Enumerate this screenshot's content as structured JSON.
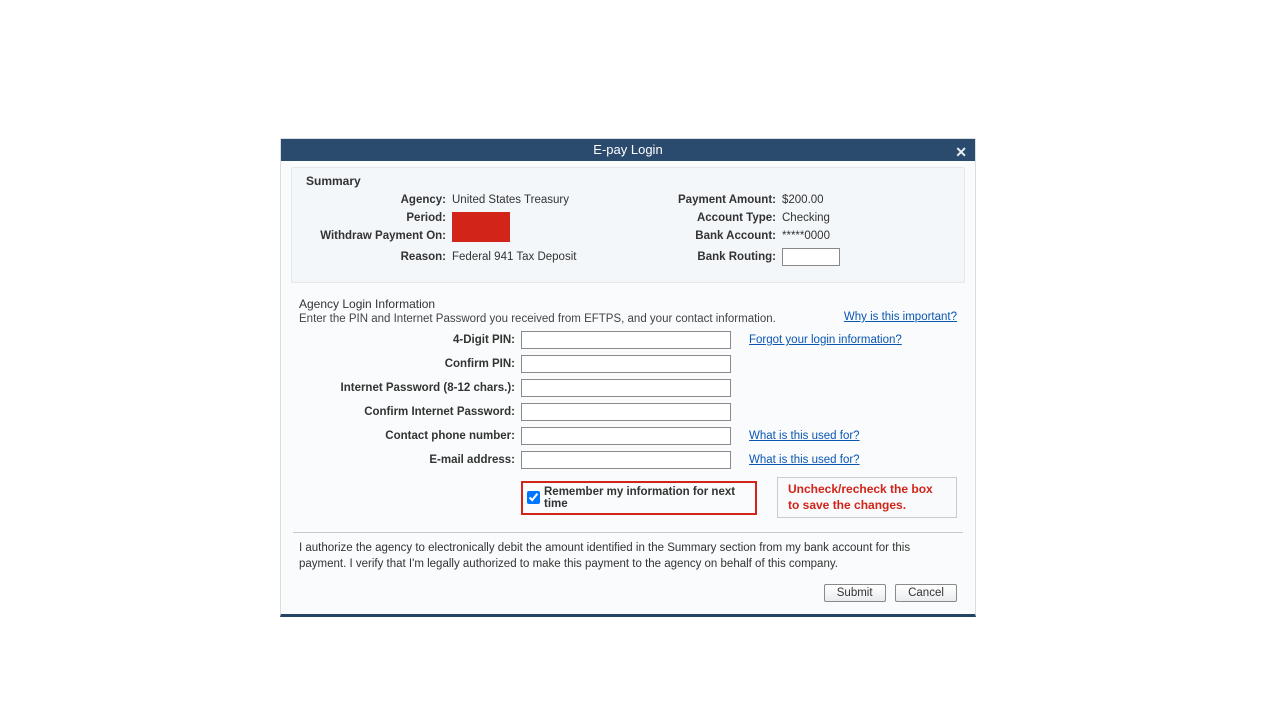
{
  "dialog": {
    "title": "E-pay Login",
    "close_symbol": "✕"
  },
  "summary": {
    "title": "Summary",
    "fields": {
      "agency_label": "Agency:",
      "agency_value": "United States Treasury",
      "period_label": "Period:",
      "withdraw_label": "Withdraw Payment On:",
      "reason_label": "Reason:",
      "reason_value": "Federal 941 Tax Deposit",
      "payment_amount_label": "Payment Amount:",
      "payment_amount_value": "$200.00",
      "account_type_label": "Account Type:",
      "account_type_value": "Checking",
      "bank_account_label": "Bank Account:",
      "bank_account_value": "*****0000",
      "bank_routing_label": "Bank Routing:"
    }
  },
  "agency": {
    "title": "Agency Login Information",
    "hint": "Enter the PIN and Internet Password you received from EFTPS, and your contact information.",
    "why_link": "Why is this important?",
    "forgot_link": "Forgot your login information?",
    "phone_used_link": "What is this used for?",
    "email_used_link": "What is this used for?",
    "labels": {
      "pin": "4-Digit PIN:",
      "confirm_pin": "Confirm PIN:",
      "password": "Internet Password (8-12 chars.):",
      "confirm_password": "Confirm Internet Password:",
      "phone": "Contact phone number:",
      "email": "E-mail address:"
    },
    "remember_label": "Remember my information for next time",
    "remember_checked": true,
    "callout": "Uncheck/recheck the box to save the changes."
  },
  "authorization": "I authorize the agency to electronically debit the amount identified in the Summary section from my bank account for this payment. I verify that I'm legally authorized to make this payment to the agency on behalf of this company.",
  "buttons": {
    "submit": "Submit",
    "cancel": "Cancel"
  }
}
